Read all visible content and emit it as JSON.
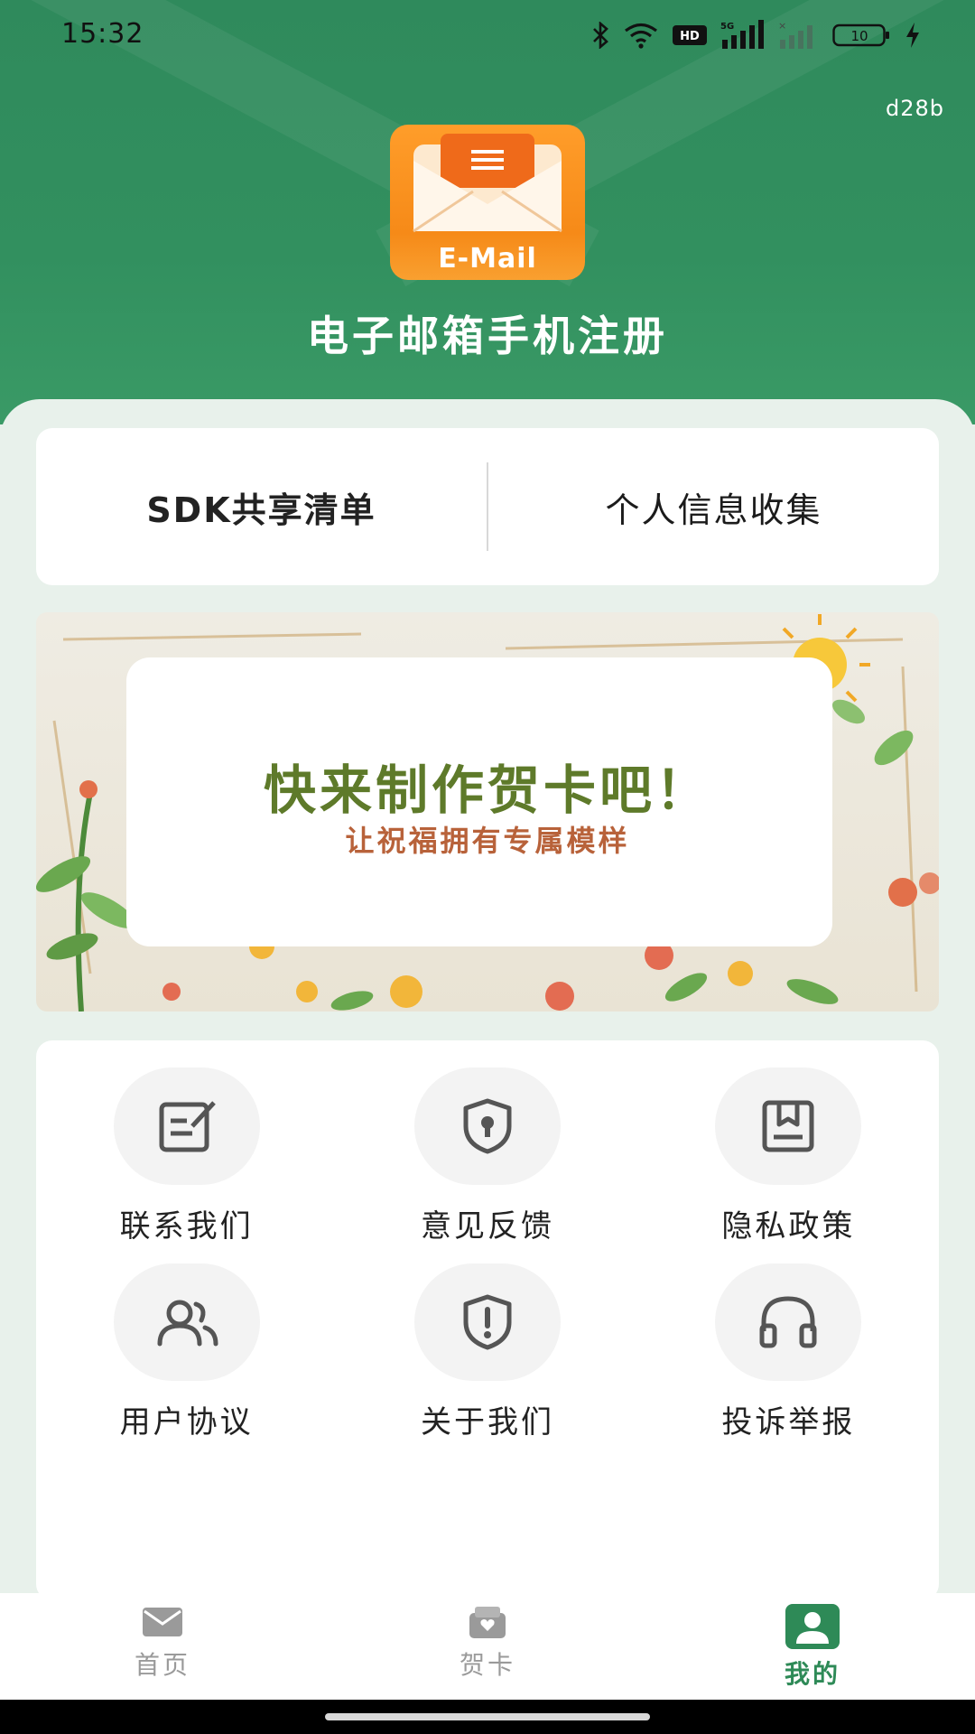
{
  "status_bar": {
    "time": "15:32",
    "network": "5G",
    "battery": "10"
  },
  "header": {
    "version": "d28b",
    "logo_text": "E-Mail",
    "app_title": "电子邮箱手机注册"
  },
  "links": {
    "sdk": "SDK共享清单",
    "personal_info": "个人信息收集"
  },
  "banner": {
    "title": "快来制作贺卡吧！",
    "subtitle": "让祝福拥有专属模样"
  },
  "menu": [
    {
      "label": "联系我们",
      "icon": "edit-note-icon"
    },
    {
      "label": "意见反馈",
      "icon": "shield-lock-icon"
    },
    {
      "label": "隐私政策",
      "icon": "book-icon"
    },
    {
      "label": "用户协议",
      "icon": "users-icon"
    },
    {
      "label": "关于我们",
      "icon": "shield-alert-icon"
    },
    {
      "label": "投诉举报",
      "icon": "headset-icon"
    }
  ],
  "tabs": [
    {
      "label": "首页",
      "icon": "mail-icon",
      "active": false
    },
    {
      "label": "贺卡",
      "icon": "card-icon",
      "active": false
    },
    {
      "label": "我的",
      "icon": "profile-icon",
      "active": true
    }
  ],
  "colors": {
    "brand_green": "#2e8a57",
    "header_green": "#32905f",
    "logo_orange": "#f68a18",
    "banner_title": "#5e7a2a",
    "banner_sub": "#b8623a"
  }
}
